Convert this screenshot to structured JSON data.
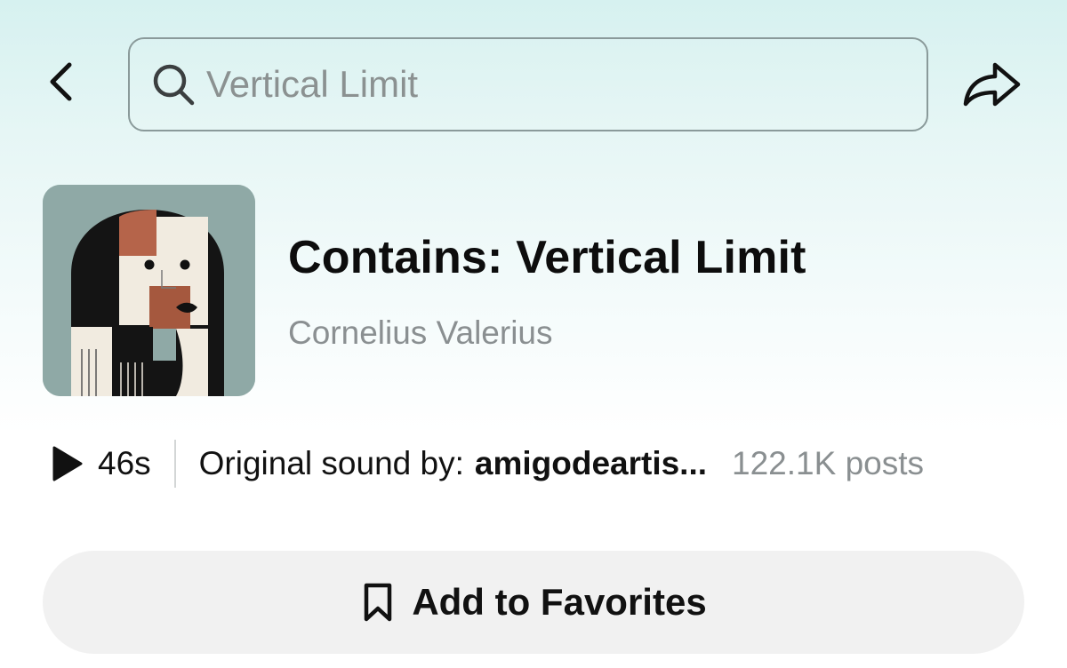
{
  "header": {
    "back_icon": "chevron-left-icon",
    "search": {
      "icon": "search-icon",
      "placeholder": "Vertical Limit",
      "value": ""
    },
    "share_icon": "share-arrow-icon"
  },
  "sound": {
    "cover_art": "abstract-portrait-cover",
    "title": "Contains: Vertical Limit",
    "artist": "Cornelius Valerius",
    "play_icon": "play-icon",
    "duration": "46s",
    "original_sound_label": "Original sound by:",
    "original_sound_author": "amigodeartis...",
    "posts_count": "122.1K posts"
  },
  "actions": {
    "favorites_icon": "bookmark-icon",
    "favorites_label": "Add to Favorites"
  },
  "colors": {
    "background_top": "#d6f1f0",
    "background_bottom": "#ffffff",
    "secondary_text": "#8a8f91",
    "button_bg": "#f1f1f1"
  }
}
